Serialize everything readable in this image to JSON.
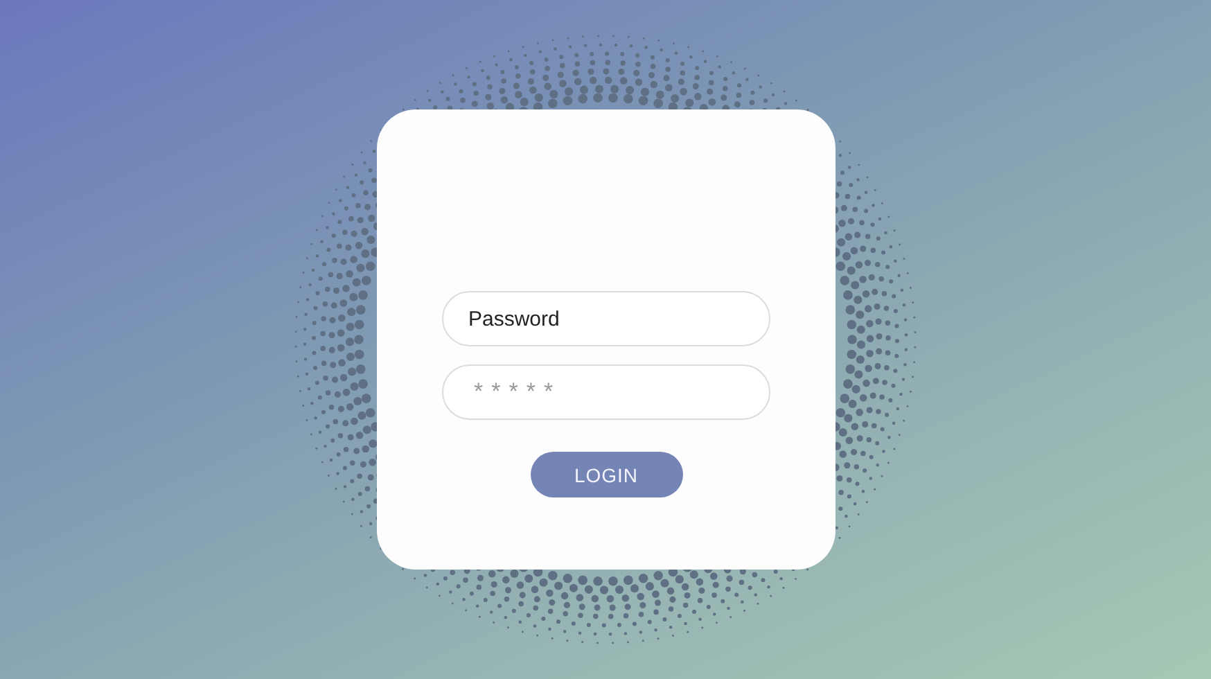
{
  "login_form": {
    "fields": [
      {
        "kind": "text",
        "value": "Password"
      },
      {
        "kind": "masked",
        "value": "*****"
      }
    ],
    "button": "LOGIN"
  }
}
